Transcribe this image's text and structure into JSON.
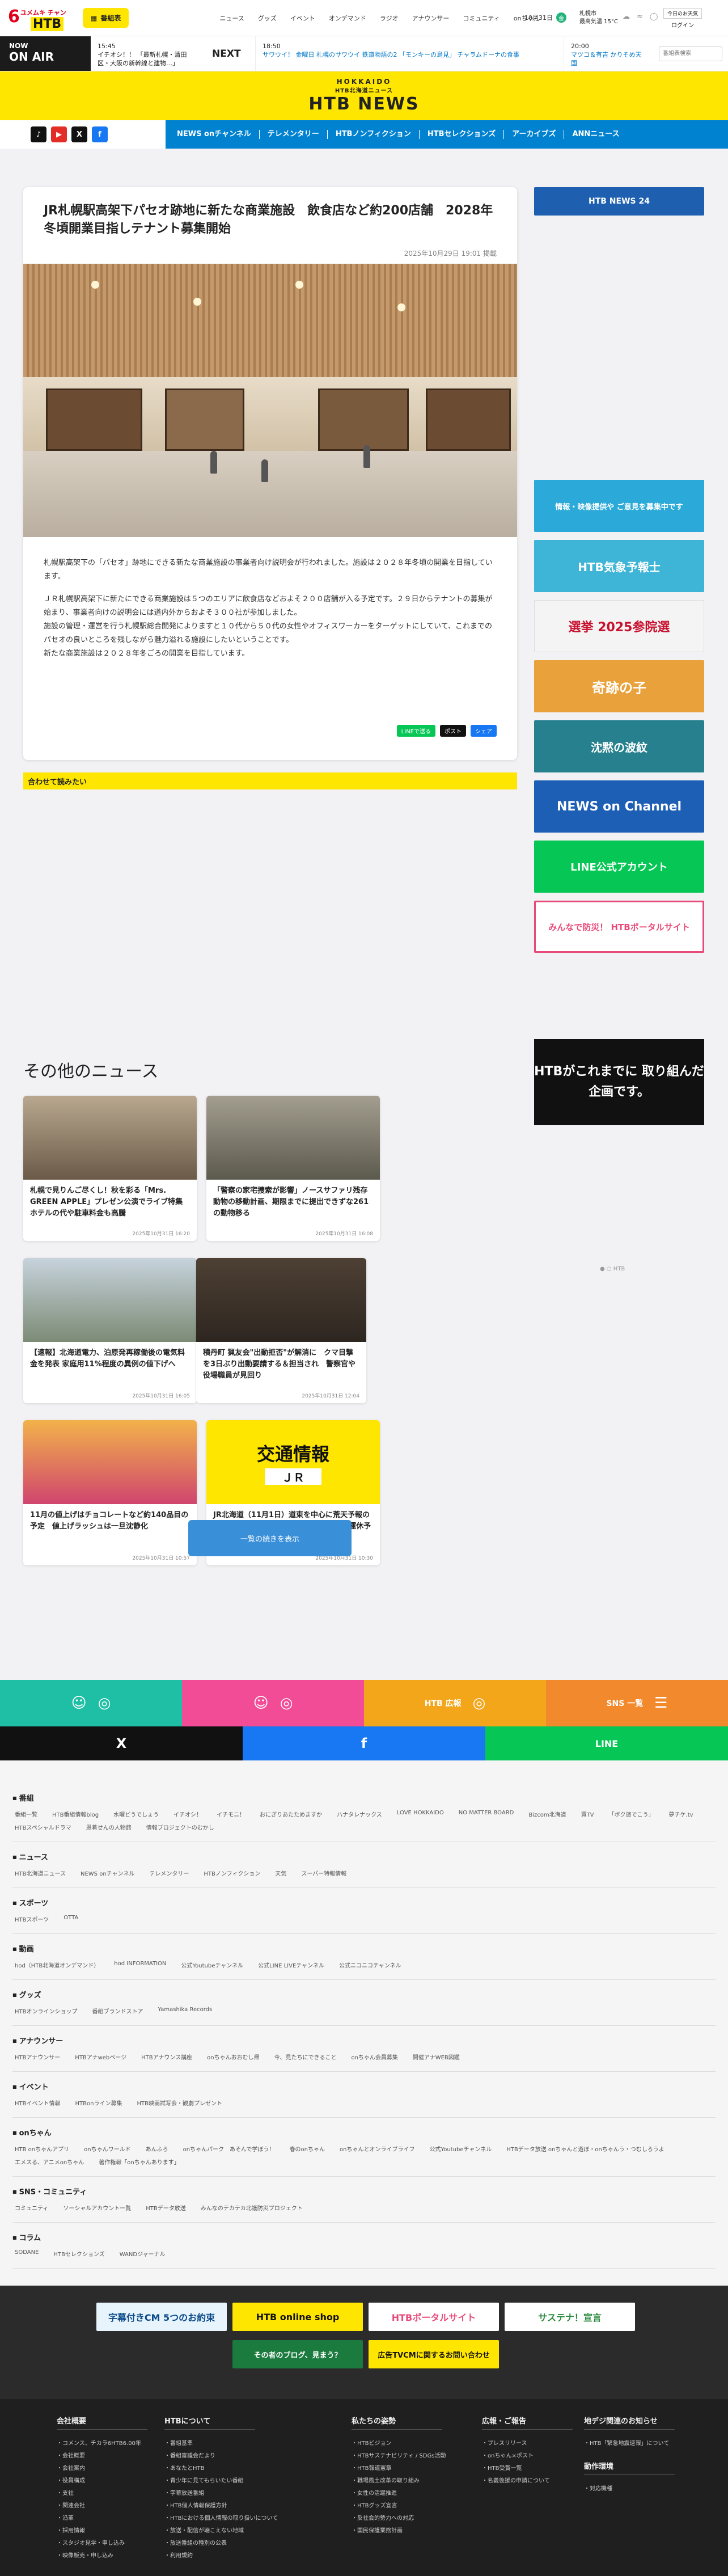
{
  "header": {
    "logo_top": "ユメムキ チャン",
    "logo_six": "6",
    "logo_htb": "HTB",
    "program_table_btn": "番組表",
    "nav": [
      "ニュース",
      "グッズ",
      "イベント",
      "オンデマンド",
      "ラジオ",
      "アナウンサー",
      "コミュニティ",
      "onちゃん"
    ],
    "date": "10月31日",
    "date_badge": "金",
    "weather_city": "札幌市",
    "weather_temp": "最高気温 15°C",
    "login_box": "今日のお天気",
    "login": "ログイン"
  },
  "onair": {
    "now": "NOW",
    "onair": "ON AIR",
    "current_time": "15:45",
    "current_title": "イチオシ！！ 「最新札幌・清田区・大阪の新幹線と建物…」",
    "next_label": "NEXT",
    "next_time": "18:50",
    "next_title": "サワウイ！ 金曜日 札幌のサワウイ 鉄道物語の2 「モンキーの鳥見」 チャラムドーナの食事",
    "next2_time": "20:00",
    "next2_title": "マツコ＆有吉 かりそめ天国",
    "search_placeholder": "番組表検索"
  },
  "brand": {
    "hokkaido": "HOKKAIDO",
    "sub": "HTB北海道ニュース",
    "name": "HTB NEWS"
  },
  "sns_top": [
    "♪",
    "▶",
    "X",
    "f"
  ],
  "mainnav": [
    "NEWS onチャンネル",
    "テレメンタリー",
    "HTBノンフィクション",
    "HTBセレクションズ",
    "アーカイブズ",
    "ANNニュース"
  ],
  "article": {
    "title": "JR札幌駅高架下パセオ跡地に新たな商業施設　飲食店など約200店舗　2028年冬頃開業目指しテナント募集開始",
    "date": "2025年10月29日 19:01 掲載",
    "paragraphs": [
      "札幌駅高架下の「パセオ」跡地にできる新たな商業施設の事業者向け説明会が行われました。施設は２０２８年冬頃の開業を目指しています。",
      "ＪＲ札幌駅高架下に新たにできる商業施設は５つのエリアに飲食店などおよそ２００店舗が入る予定です。２９日からテナントの募集が始まり、事業者向けの説明会には道内外からおよそ３００社が参加しました。\n施設の管理・運営を行う札幌駅総合開発によりますと１０代から５０代の女性やオフィスワーカーをターゲットにしていて、これまでのパセオの良いところを残しながら魅力溢れる施設にしたいということです。\n新たな商業施設は２０２８年冬ごろの開業を目指しています。"
    ],
    "share": [
      "LINEで送る",
      "ポスト",
      "シェア"
    ],
    "related": "合わせて読みたい"
  },
  "side_ads": [
    {
      "text": "HTB NEWS 24",
      "color": "#1e5fb0"
    },
    {
      "text": "情報・映像提供や ご意見を募集中です",
      "color": "#2ba9d8"
    },
    {
      "text": "HTB気象予報士",
      "color": "#3eb4d6"
    },
    {
      "text": "選挙 2025参院選",
      "color": "#f4f4f4"
    },
    {
      "text": "奇跡の子",
      "color": "#e9a23b"
    },
    {
      "text": "沈黙の波紋",
      "color": "#27808e"
    },
    {
      "text": "NEWS on Channel",
      "color": "#1d5fb5"
    },
    {
      "text": "LINE公式アカウント",
      "color": "#06c755"
    },
    {
      "text": "みんなで防災！ HTBポータルサイト",
      "color": "#e84b7a"
    }
  ],
  "other": {
    "heading": "その他のニュース",
    "side_ad": "HTBがこれまでに 取り組んだ企画です。",
    "cards": [
      {
        "title": "札幌で見りんご尽くし！秋を彩る「Mrs. GREEN APPLE」プレゼン公演でライブ特集 ホテルの代や駐車料金も高騰",
        "date": "2025年10月31日 16:20"
      },
      {
        "title": "「警察の家宅捜索が影響」ノースサファリ残存動物の移動計画、期限までに提出できずな261の動物移る",
        "date": "2025年10月31日 16:08"
      },
      {
        "title": "【速報】北海道電力、泊原発再稼働後の電気料金を発表 家庭用11%程度の異例の値下げへ",
        "date": "2025年10月31日 16:05"
      },
      {
        "title": "積丹町 猟友会\"出動拒否\"が解消に　クマ目撃を3日ぶり出動要請する＆担当され　警察官や役場職員が見回り",
        "date": "2025年10月31日 12:04"
      },
      {
        "title": "11月の値上げはチョコレートなど約140品目の予定　値上げラッシュは一旦沈静化",
        "date": "2025年10月31日 10:57"
      },
      {
        "title": "JR北海道（11月1日）道東を中心に荒天予報のため、道東方面の特急列車を中心に18本運休予定",
        "date": "2025年10月31日 10:30"
      }
    ],
    "more": "一覧の続きを表示",
    "traffic_title": "交通情報",
    "traffic_jr": "ＪＲ"
  },
  "bands": [
    {
      "label": "",
      "color": "#1fbfa5"
    },
    {
      "label": "",
      "color": "#f34c97"
    },
    {
      "label": "HTB 広報",
      "color": "#f4a61b"
    },
    {
      "label": "SNS 一覧",
      "color": "#f28a2d"
    }
  ],
  "sharebar": [
    {
      "label": "X",
      "color": "#111111"
    },
    {
      "label": "f",
      "color": "#1877f2"
    },
    {
      "label": "LINE",
      "color": "#06c755"
    }
  ],
  "footer_sections": [
    {
      "head": "番組",
      "items": [
        "番組一覧",
        "HTB番組情報blog",
        "水曜どうでしょう",
        "イチオシ！",
        "イチモニ！",
        "おにぎりあたためますか",
        "ハナタレナックス",
        "LOVE HOKKAIDO",
        "NO MATTER BOARD",
        "Bizcom北海道",
        "買TV",
        "「ボク旅でこう」",
        "夢チケ.tv",
        "HTBスペシャルドラマ",
        "恩着せんの人物館",
        "情報プロジェクトのむかし"
      ]
    },
    {
      "head": "ニュース",
      "items": [
        "HTB北海道ニュース",
        "NEWS onチャンネル",
        "テレメンタリー",
        "HTBノンフィクション",
        "天気",
        "スーパー特報情報"
      ]
    },
    {
      "head": "スポーツ",
      "items": [
        "HTBスポーツ",
        "OTTA"
      ]
    },
    {
      "head": "動画",
      "items": [
        "hod（HTB北海道オンデマンド）",
        "hod INFORMATION",
        "公式Youtubeチャンネル",
        "公式LINE LIVEチャンネル",
        "公式ニコニコチャンネル"
      ]
    },
    {
      "head": "グッズ",
      "items": [
        "HTBオンラインショップ",
        "番組ブランドストア",
        "Yamashika Records"
      ]
    },
    {
      "head": "アナウンサー",
      "items": [
        "HTBアナウンサー",
        "HTBアナwebページ",
        "HTBアナウンス講座",
        "onちゃんおおむし帰",
        "今、見たちにできること",
        "onちゃん会員募集",
        "開催アナWEB図鑑"
      ]
    },
    {
      "head": "イベント",
      "items": [
        "HTBイベント情報",
        "HTBonライン募集",
        "HTB映画試写会・観劇プレゼント"
      ]
    },
    {
      "head": "onちゃん",
      "items": [
        "HTB onちゃんアプリ",
        "onちゃんワールド",
        "あんふろ",
        "onちゃんパーク　あそんで学ぼう！",
        "春のonちゃん",
        "onちゃんとオンライブライフ",
        "公式Youtubeチャンネル",
        "HTBデータ放送 onちゃんと遊ぼ・onちゃんう・つむしろうよ",
        "エメスる、アニメonちゃん",
        "著作権報「onちゃんあります」"
      ]
    },
    {
      "head": "SNS・コミュニティ",
      "items": [
        "コミュニティ",
        "ソーシャルアカウント一覧",
        "HTBデータ放送",
        "みんなのテカテカ北護防災プロジェクト"
      ]
    },
    {
      "head": "コラム",
      "items": [
        "SODANE",
        "HTBセレクションズ",
        "WANDジャーナル"
      ]
    }
  ],
  "banners": [
    {
      "text": "字幕付きCM 5つのお約束",
      "color": "#e8f4fb"
    },
    {
      "text": "HTB online shop",
      "color": "#ffe600"
    },
    {
      "text": "HTBポータルサイト",
      "color": "#e84b7a"
    },
    {
      "text": "サステナ！宣言",
      "color": "#ffffff"
    },
    {
      "text": "その者のブログ、見まう？",
      "color": "#1b7a3e"
    },
    {
      "text": "広告TVCMに関するお問い合わせ",
      "color": "#ffe600"
    }
  ],
  "footer_cols": [
    {
      "head": "会社概要",
      "items": [
        "コメンス、チカラ6HTB6.00年",
        "会社概要",
        "会社案内",
        "役員構成",
        "支社",
        "関連会社",
        "沿革",
        "採用情報",
        "スタジオ見学・申し込み",
        "映像販売・申し込み"
      ]
    },
    {
      "head": "HTBについて",
      "items": [
        "番組基準",
        "番組審議会だより",
        "あなたとHTB",
        "青少年に見てもらいたい番組",
        "字幕放送番組",
        "HTB個人情報保護方針",
        "HTBにおける個人情報の取り扱いについて",
        "放送・配信が聴こえない地域",
        "放送番組の種別の公表",
        "利用規約"
      ]
    },
    {
      "head": "私たちの姿勢",
      "items": [
        "HTBビジョン",
        "HTBサステナビリティ / SDGs活動",
        "HTB報道憲章",
        "職場風土改革の取り組み",
        "女性の活躍推進",
        "HTBグッズ宣言",
        "反社会的勢力への対応",
        "国民保護業務計画"
      ]
    },
    {
      "head": "広報・ご報告",
      "items": [
        "プレスリリース",
        "onちゃん×ポスト",
        "HTB受賞一覧",
        "名義後援の申請について"
      ]
    },
    {
      "head": "地デジ関連のお知らせ",
      "items": [
        "HTB「緊急地震速報」について"
      ]
    }
  ],
  "footer_extra_head": "動作環境",
  "footer_extra_item": "対応機種"
}
